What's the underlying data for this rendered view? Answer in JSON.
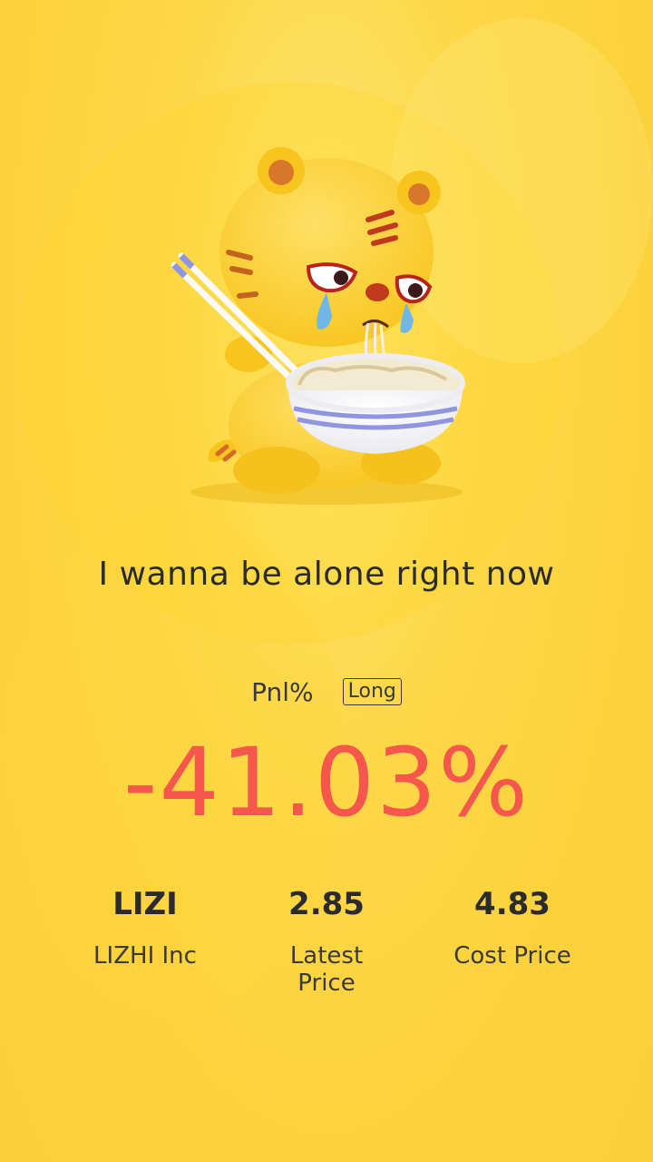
{
  "headline": "I wanna be alone right now",
  "pnl": {
    "label": "Pnl%",
    "position_badge": "Long",
    "value": "-41.03%",
    "value_color": "#f5574d"
  },
  "stats": [
    {
      "value": "LIZI",
      "caption": "LIZHI Inc"
    },
    {
      "value": "2.85",
      "caption": "Latest Price"
    },
    {
      "value": "4.83",
      "caption": "Cost Price"
    }
  ],
  "mascot": {
    "icon": "crying-tiger-eating-noodles-illustration"
  },
  "colors": {
    "background": "#fcd23c",
    "text": "#2b2b2b",
    "loss": "#f5574d"
  }
}
